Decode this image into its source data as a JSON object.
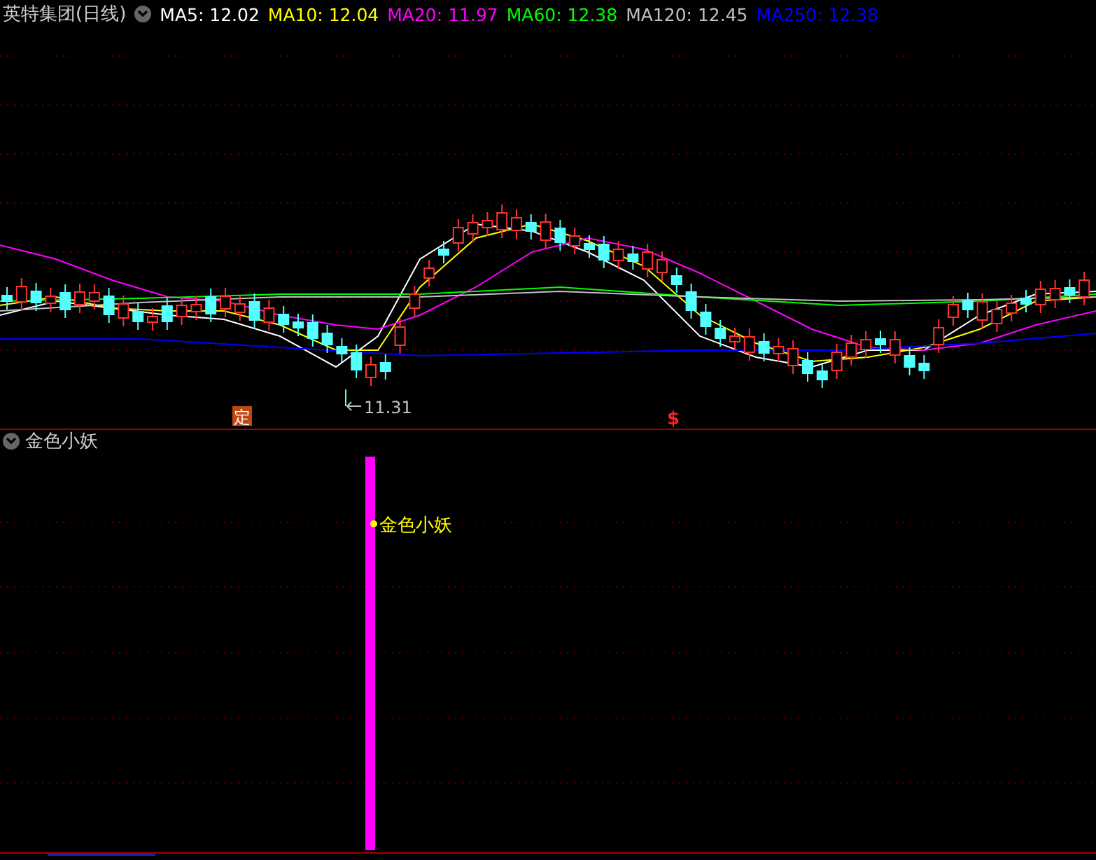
{
  "header": {
    "title": "英特集团(日线)",
    "moving_averages": [
      {
        "label": "MA5: 12.02",
        "color": "#ffffff"
      },
      {
        "label": "MA10: 12.04",
        "color": "#ffff00"
      },
      {
        "label": "MA20: 11.97",
        "color": "#ff00ff"
      },
      {
        "label": "MA60: 12.38",
        "color": "#00ff00"
      },
      {
        "label": "MA120: 12.45",
        "color": "#c0c0c0"
      },
      {
        "label": "MA250: 12.38",
        "color": "#0000ff"
      }
    ]
  },
  "price_chart": {
    "low_label": "11.31",
    "markers": [
      {
        "kind": "badge",
        "text": "定"
      },
      {
        "kind": "signal",
        "text": "$"
      }
    ]
  },
  "indicator_panel": {
    "title": "金色小妖",
    "signal_label": "金色小妖"
  }
}
